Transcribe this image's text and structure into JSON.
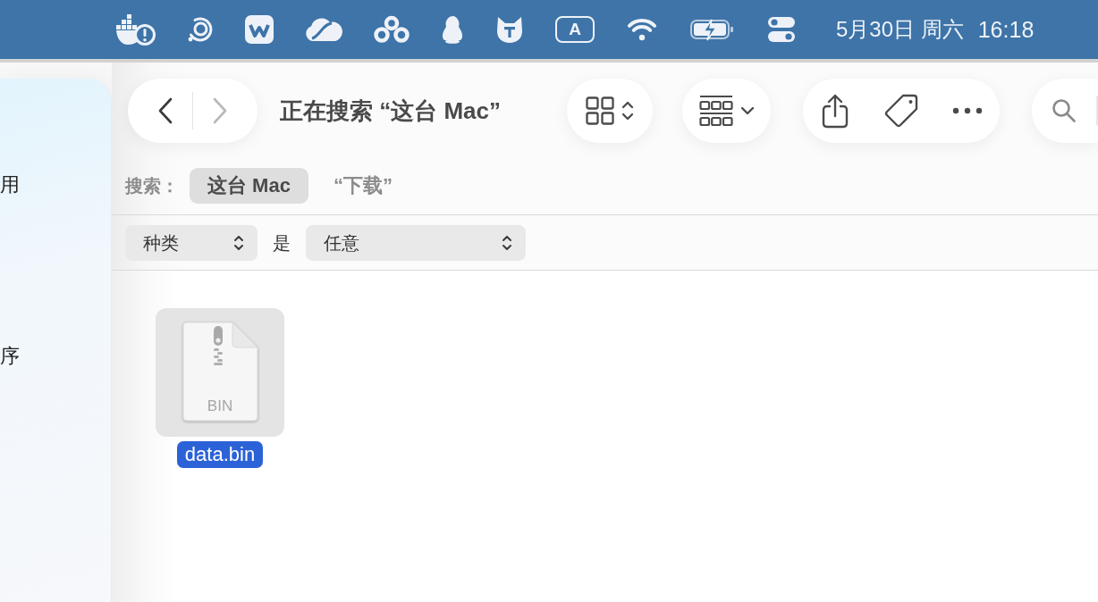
{
  "menu_bar": {
    "input_source": "A",
    "date": "5月30日 周六",
    "time": "16:18"
  },
  "sidebar": {
    "items": [
      {
        "label": "用"
      },
      {
        "label": "序"
      }
    ]
  },
  "toolbar": {
    "back": {
      "disabled": false
    },
    "forward": {
      "disabled": true
    },
    "title": "正在搜索 “这台 Mac”"
  },
  "search_scope": {
    "label": "搜索：",
    "options": [
      {
        "label": "这台 Mac",
        "selected": true
      },
      {
        "label": "“下载”",
        "selected": false
      }
    ]
  },
  "filter": {
    "attribute": "种类",
    "operator": "是",
    "value": "任意"
  },
  "files": [
    {
      "name": "data.bin",
      "type_label": "BIN",
      "selected": true
    }
  ]
}
